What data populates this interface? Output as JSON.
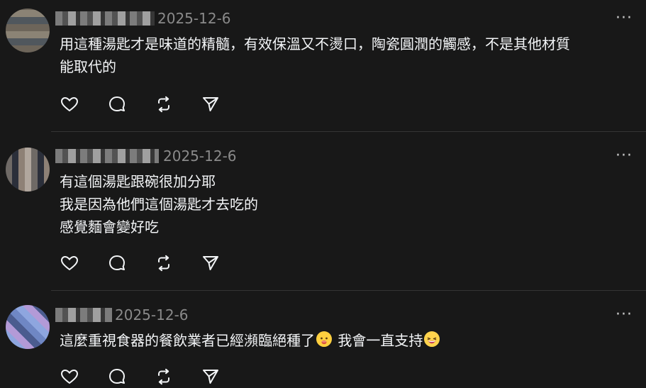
{
  "posts": [
    {
      "date": "2025-12-6",
      "text": "用這種湯匙才是味道的精髓，有效保溫又不燙口，陶瓷圓潤的觸感，不是其他材質\n能取代的"
    },
    {
      "date": "2025-12-6",
      "text": "有這個湯匙跟碗很加分耶\n我是因為他們這個湯匙才去吃的\n感覺麵會變好吃"
    },
    {
      "date": "2025-12-6",
      "text_part1": "這麼重視食器的餐飲業者已經瀕臨絕種了",
      "text_part2": " 我會一直支持"
    }
  ],
  "more_label": "···",
  "icons": [
    "heart-icon",
    "comment-icon",
    "repost-icon",
    "share-icon"
  ]
}
